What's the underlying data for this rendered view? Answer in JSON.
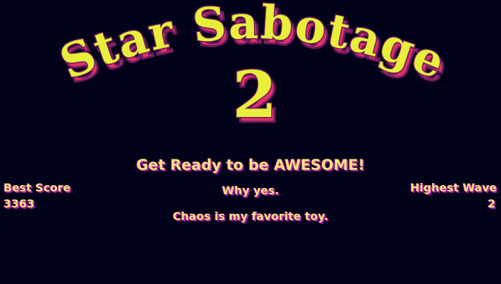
{
  "title": {
    "line1": "Star Sabotage",
    "line2": "2"
  },
  "tagline": "Get Ready to be AWESOME!",
  "sublines": [
    "Why yes.",
    "Chaos is my favorite toy."
  ],
  "stats": {
    "best_score_label": "Best Score",
    "best_score_value": "3363",
    "highest_wave_label": "Highest Wave",
    "highest_wave_value": "2"
  },
  "colors": {
    "background": "#02021a",
    "text_fill": "#f4e27a",
    "text_shadow": "#b01ca8",
    "logo_fill": "#e8ef3a",
    "logo_outline": "#6a1a5e",
    "logo_shadow": "#e0306a"
  }
}
